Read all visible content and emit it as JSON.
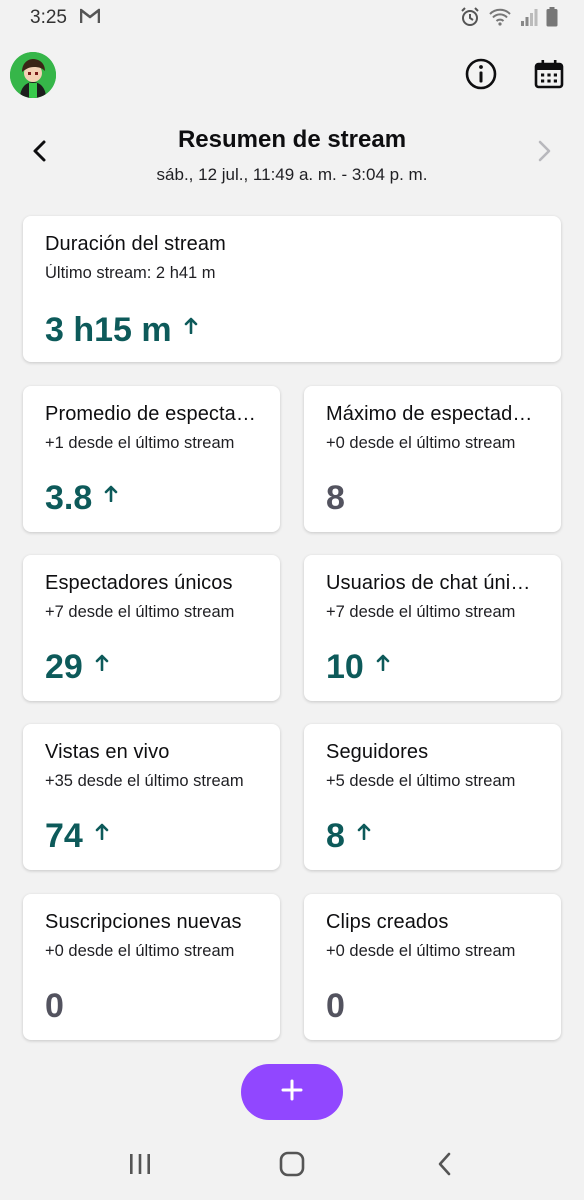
{
  "status_bar": {
    "time": "3:25",
    "icons": [
      "gmail-icon",
      "alarm-icon",
      "wifi-icon",
      "signal-icon",
      "battery-icon"
    ]
  },
  "top_bar": {
    "icons": [
      "info-icon",
      "calendar-icon"
    ]
  },
  "header": {
    "title": "Resumen de stream",
    "subtitle": "sáb., 12 jul., 11:49 a. m. - 3:04 p. m."
  },
  "duration_card": {
    "title": "Duración del stream",
    "subtitle": "Último stream: 2 h41 m",
    "value": "3 h15 m",
    "trend": "up"
  },
  "stats": [
    {
      "title": "Promedio de espectadores",
      "subtitle": "+1 desde el último stream",
      "value": "3.8",
      "trend": "up"
    },
    {
      "title": "Máximo de espectadores",
      "subtitle": "+0 desde el último stream",
      "value": "8",
      "trend": "none"
    },
    {
      "title": "Espectadores únicos",
      "subtitle": "+7 desde el último stream",
      "value": "29",
      "trend": "up"
    },
    {
      "title": "Usuarios de chat únicos",
      "subtitle": "+7 desde el último stream",
      "value": "10",
      "trend": "up"
    },
    {
      "title": "Vistas en vivo",
      "subtitle": "+35 desde el último stream",
      "value": "74",
      "trend": "up"
    },
    {
      "title": "Seguidores",
      "subtitle": "+5 desde el último stream",
      "value": "8",
      "trend": "up"
    },
    {
      "title": "Suscripciones nuevas",
      "subtitle": "+0 desde el último stream",
      "value": "0",
      "trend": "none"
    },
    {
      "title": "Clips creados",
      "subtitle": "+0 desde el último stream",
      "value": "0",
      "trend": "none"
    }
  ],
  "fab": {
    "icon": "plus-icon"
  },
  "colors": {
    "accent": "#9147ff",
    "value_positive": "#0d5a5a",
    "value_neutral": "#53535f",
    "background": "#f2f2f2"
  }
}
